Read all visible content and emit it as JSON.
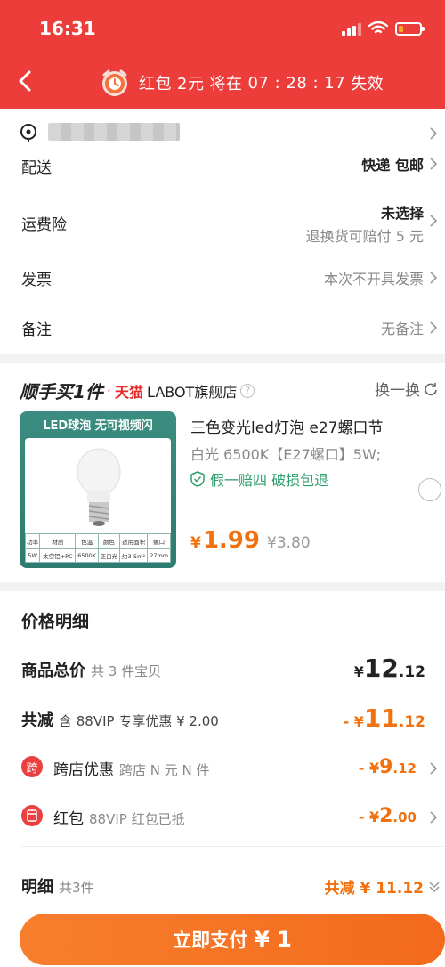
{
  "status_bar": {
    "time": "16:31"
  },
  "header": {
    "timer_label": "红包",
    "timer_amount": "2元",
    "timer_prefix": "将在",
    "timer_countdown": "07 : 28 : 17",
    "timer_suffix": "失效"
  },
  "delivery": {
    "address_hidden": "",
    "shipping_label": "配送",
    "shipping_value": "快递 包邮",
    "insurance_label": "运费险",
    "insurance_value": "未选择",
    "insurance_sub": "退换货可赔付 5 元",
    "invoice_label": "发票",
    "invoice_value": "本次不开具发票",
    "note_label": "备注",
    "note_value": "无备注"
  },
  "shop": {
    "brand": "顺手买1件",
    "dot": "·",
    "platform": "天猫",
    "store_name": "LABOT旗舰店",
    "swap_label": "换一换",
    "product": {
      "image_banner": "LED球泡 无可视频闪",
      "image_table_headers": [
        "功率",
        "材质",
        "色温",
        "颜色",
        "适用面积",
        "螺口"
      ],
      "image_table_values": [
        "5W",
        "太空铝+PC",
        "6500K",
        "正白光",
        "约3-5m²",
        "27mm"
      ],
      "title": "三色变光led灯泡 e27螺口节",
      "spec": "白光 6500K【E27螺口】5W;",
      "guarantee": "假一赔四  破损包退",
      "price_symbol": "¥",
      "price": "1.99",
      "original_price": "¥3.80"
    }
  },
  "price_detail": {
    "section_title": "价格明细",
    "total_label": "商品总价",
    "total_sub": "共 3 件宝贝",
    "total_symbol": "¥",
    "total_int": "12",
    "total_dec": ".12",
    "discount_label": "共减",
    "discount_sub": "含 88VIP 专享优惠 ¥ 2.00",
    "discount_prefix": "- ¥",
    "discount_int": "11",
    "discount_dec": ".12",
    "cross_icon": "跨",
    "cross_label": "跨店优惠",
    "cross_sub": "跨店 N 元 N 件",
    "cross_prefix": "- ¥",
    "cross_int": "9",
    "cross_dec": ".12",
    "redpacket_label": "红包",
    "redpacket_sub": "88VIP 红包已抵",
    "redpacket_prefix": "- ¥",
    "redpacket_int": "2",
    "redpacket_dec": ".00",
    "detail_label": "明细",
    "detail_sub": "共3件",
    "detail_value": "共减 ¥ 11.12"
  },
  "pay": {
    "label": "立即支付",
    "amount": "¥ 1"
  },
  "colors": {
    "header_red": "#ec3d3a",
    "accent_orange": "#f2700d",
    "guarantee_green": "#2e9e6e"
  },
  "icons": [
    "back-chevron-icon",
    "alarm-clock-icon",
    "location-pin-icon",
    "chevron-right-icon",
    "shield-check-icon",
    "refresh-icon",
    "help-icon",
    "red-packet-icon"
  ]
}
